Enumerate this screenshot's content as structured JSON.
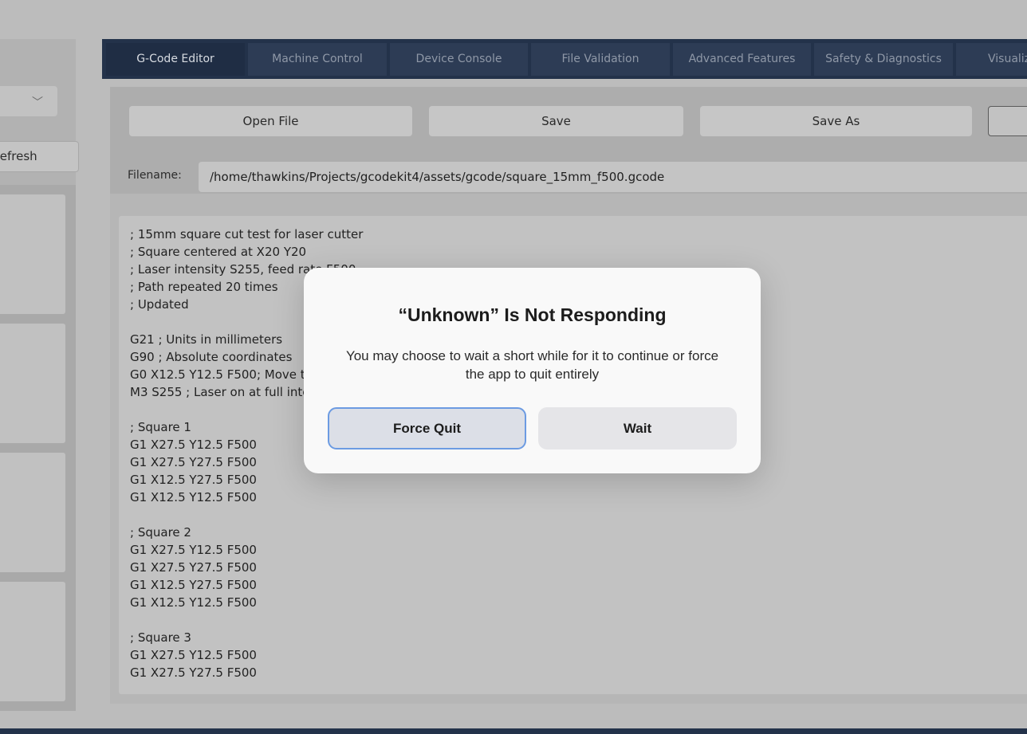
{
  "sidebar": {
    "refresh_label": "Refresh",
    "select_chevron": "chevron-down-icon"
  },
  "tabs": [
    {
      "label": "G-Code Editor",
      "active": true
    },
    {
      "label": "Machine Control",
      "active": false
    },
    {
      "label": "Device Console",
      "active": false
    },
    {
      "label": "File Validation",
      "active": false
    },
    {
      "label": "Advanced Features",
      "active": false
    },
    {
      "label": "Safety & Diagnostics",
      "active": false
    },
    {
      "label": "Visualizer",
      "active": false
    }
  ],
  "toolbar": {
    "open_label": "Open File",
    "save_label": "Save",
    "save_as_label": "Save As"
  },
  "filename": {
    "label": "Filename:",
    "value": "/home/thawkins/Projects/gcodekit4/assets/gcode/square_15mm_f500.gcode"
  },
  "editor": {
    "lines": [
      "; 15mm square cut test for laser cutter",
      "; Square centered at X20 Y20",
      "; Laser intensity S255, feed rate F500",
      "; Path repeated 20 times",
      "; Updated",
      "",
      "G21 ; Units in millimeters",
      "G90 ; Absolute coordinates",
      "G0 X12.5 Y12.5 F500; Move to start",
      "M3 S255 ; Laser on at full intensity",
      "",
      "; Square 1",
      "G1 X27.5 Y12.5 F500",
      "G1 X27.5 Y27.5 F500",
      "G1 X12.5 Y27.5 F500",
      "G1 X12.5 Y12.5 F500",
      "",
      "; Square 2",
      "G1 X27.5 Y12.5 F500",
      "G1 X27.5 Y27.5 F500",
      "G1 X12.5 Y27.5 F500",
      "G1 X12.5 Y12.5 F500",
      "",
      "; Square 3",
      "G1 X27.5 Y12.5 F500",
      "G1 X27.5 Y27.5 F500"
    ]
  },
  "dialog": {
    "title": "“Unknown” Is Not Responding",
    "message": "You may choose to wait a short while for it to continue or force the app to quit entirely",
    "force_quit_label": "Force Quit",
    "wait_label": "Wait"
  },
  "colors": {
    "tab_bar": "#23324a",
    "dialog_focus": "#6c9be2"
  }
}
